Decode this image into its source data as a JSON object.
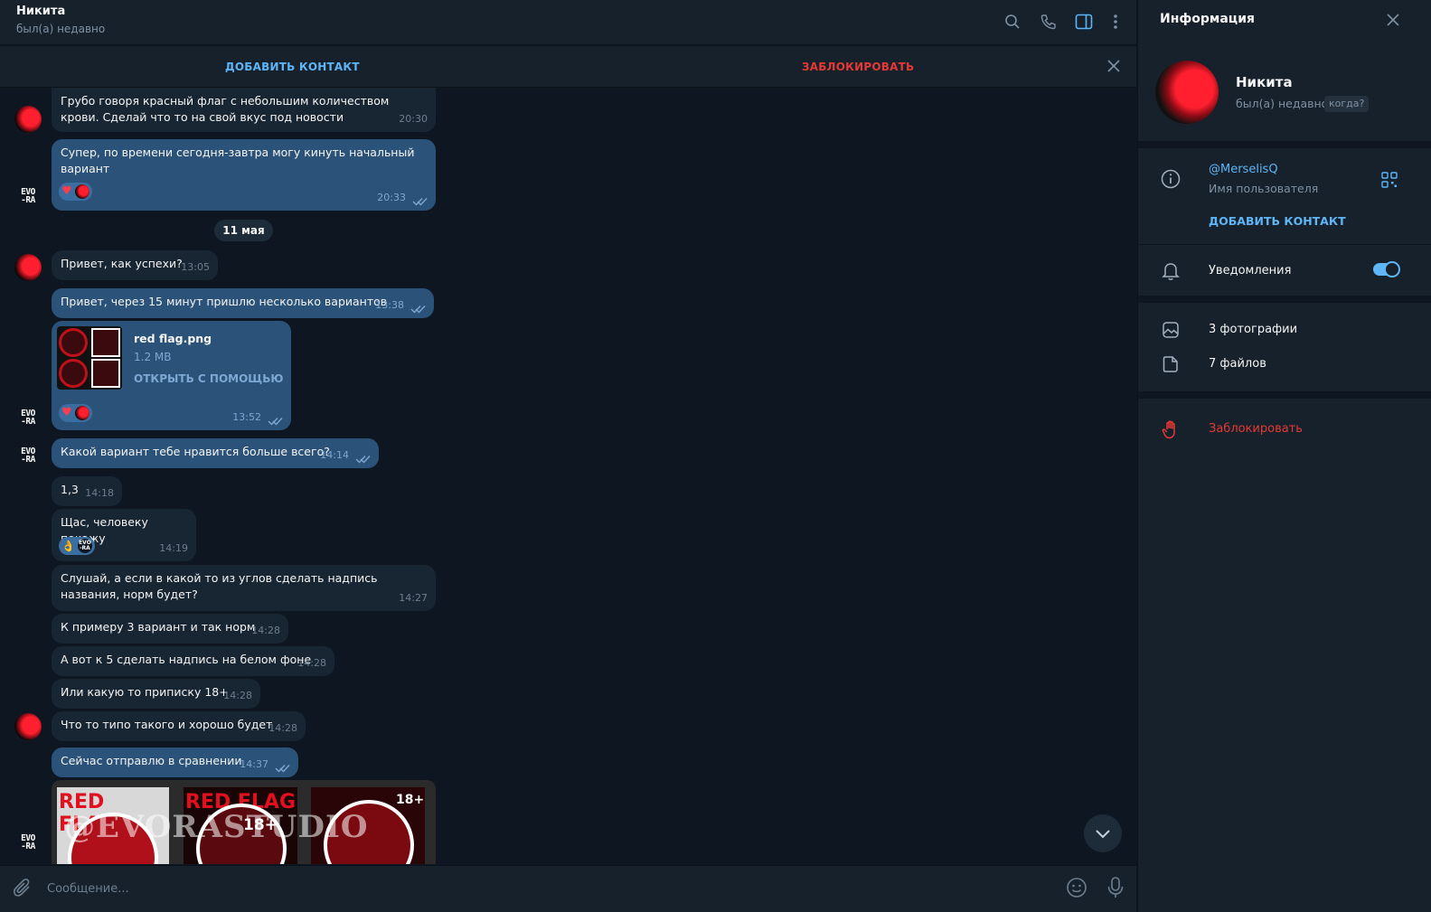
{
  "chat": {
    "title": "Никита",
    "status": "был(а) недавно"
  },
  "action_bar": {
    "add_contact": "ДОБАВИТЬ КОНТАКТ",
    "block": "ЗАБЛОКИРОВАТЬ"
  },
  "date_separator": "11 мая",
  "messages": [
    {
      "dir": "in",
      "text": "Грубо говоря красный флаг с небольшим количеством крови. Сделай что то на свой вкус под новости",
      "time": "20:30"
    },
    {
      "dir": "out",
      "text": "Супер, по времени сегодня-завтра могу кинуть начальный вариант",
      "time": "20:33",
      "reactions": [
        "heart"
      ]
    },
    {
      "dir": "in",
      "text": "Привет, как успехи?",
      "time": "13:05"
    },
    {
      "dir": "out",
      "text": "Привет, через 15 минут пришлю несколько вариантов",
      "time": "13:38"
    },
    {
      "dir": "out",
      "file_name": "red flag.png",
      "file_size": "1.2 MB",
      "file_action": "ОТКРЫТЬ С ПОМОЩЬЮ",
      "time": "13:52",
      "reactions": [
        "heart"
      ]
    },
    {
      "dir": "out",
      "text": "Какой вариант тебе нравится больше всего?",
      "time": "14:14"
    },
    {
      "dir": "in",
      "text": "1,3",
      "time": "14:18"
    },
    {
      "dir": "in",
      "text": "Щас, человеку покажу",
      "time": "14:19",
      "reactions": [
        "ok-hand"
      ]
    },
    {
      "dir": "in",
      "text": "Слушай, а если в какой то из углов сделать надпись названия, норм будет?",
      "time": "14:27"
    },
    {
      "dir": "in",
      "text": "К примеру 3 вариант и так норм",
      "time": "14:28"
    },
    {
      "dir": "in",
      "text": "А вот к 5 сделать надпись на белом фоне",
      "time": "14:28"
    },
    {
      "dir": "in",
      "text": "Или какую то приписку 18+",
      "time": "14:28"
    },
    {
      "dir": "in",
      "text": "Что то типо такого и хорошо будет",
      "time": "14:28"
    },
    {
      "dir": "out",
      "text": "Сейчас отправлю в сравнении",
      "time": "14:37"
    }
  ],
  "images_preview": {
    "watermark": "@EVORASTUDIO",
    "thumb_text": "RED FLAG",
    "badge": "18+"
  },
  "composer": {
    "placeholder": "Сообщение..."
  },
  "info": {
    "title": "Информация",
    "name": "Никита",
    "status": "был(а) недавно",
    "when_badge": "когда?",
    "username": "@MerselisQ",
    "username_label": "Имя пользователя",
    "add_contact": "ДОБАВИТЬ КОНТАКТ",
    "notifications": "Уведомления",
    "notifications_on": true,
    "photos": "3 фотографии",
    "files": "7 файлов",
    "block": "Заблокировать"
  },
  "avatar_text": "EVO\n-RA",
  "colors": {
    "bg": "#0e1621",
    "panel": "#17212b",
    "bubble_in": "#182533",
    "bubble_out": "#2b5278",
    "accent": "#5eb5f7",
    "danger": "#e53935"
  }
}
